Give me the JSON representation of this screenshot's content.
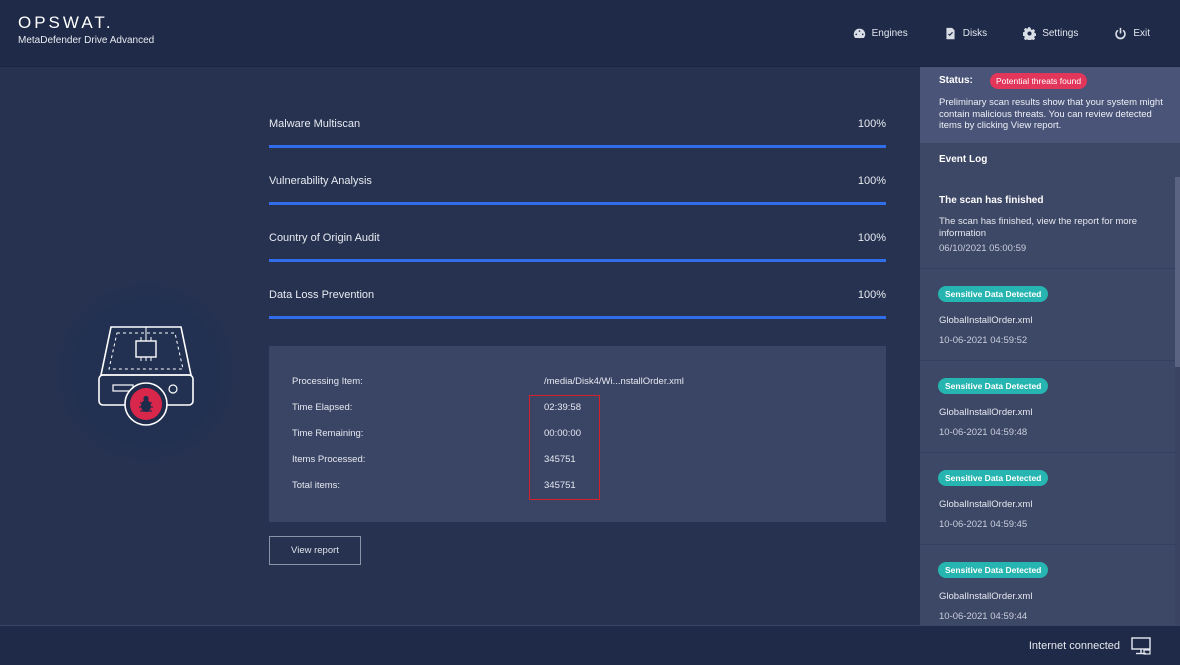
{
  "header": {
    "logo": "OPSWAT.",
    "product": "MetaDefender Drive Advanced",
    "nav": [
      {
        "label": "Engines",
        "icon": "gauge-icon"
      },
      {
        "label": "Disks",
        "icon": "disk-icon"
      },
      {
        "label": "Settings",
        "icon": "gear-icon"
      },
      {
        "label": "Exit",
        "icon": "power-icon"
      }
    ]
  },
  "progress": [
    {
      "label": "Malware Multiscan",
      "percent_text": "100%",
      "percent": 100
    },
    {
      "label": "Vulnerability Analysis",
      "percent_text": "100%",
      "percent": 100
    },
    {
      "label": "Country of Origin Audit",
      "percent_text": "100%",
      "percent": 100
    },
    {
      "label": "Data Loss Prevention",
      "percent_text": "100%",
      "percent": 100
    }
  ],
  "info": {
    "processing_item_label": "Processing Item:",
    "processing_item_value": "/media/Disk4/Wi...nstallOrder.xml",
    "time_elapsed_label": "Time Elapsed:",
    "time_elapsed_value": "02:39:58",
    "time_remaining_label": "Time Remaining:",
    "time_remaining_value": "00:00:00",
    "items_processed_label": "Items Processed:",
    "items_processed_value": "345751",
    "total_items_label": "Total items:",
    "total_items_value": "345751"
  },
  "view_report_label": "View report",
  "sidebar": {
    "status_label": "Status:",
    "status_badge": "Potential threats found",
    "status_text": "Preliminary scan results show that your system might contain malicious threats. You can review detected items by clicking View report.",
    "event_log_title": "Event Log",
    "first_event": {
      "title": "The scan has finished",
      "desc": "The scan has finished, view the report for more information",
      "time": "06/10/2021 05:00:59"
    },
    "events": [
      {
        "badge": "Sensitive Data Detected",
        "file": "GlobalInstallOrder.xml",
        "time": "10-06-2021 04:59:52"
      },
      {
        "badge": "Sensitive Data Detected",
        "file": "GlobalInstallOrder.xml",
        "time": "10-06-2021 04:59:48"
      },
      {
        "badge": "Sensitive Data Detected",
        "file": "GlobalInstallOrder.xml",
        "time": "10-06-2021 04:59:45"
      },
      {
        "badge": "Sensitive Data Detected",
        "file": "GlobalInstallOrder.xml",
        "time": "10-06-2021 04:59:44"
      }
    ]
  },
  "footer": {
    "status": "Internet connected",
    "icon": "monitor-icon"
  },
  "colors": {
    "progress_fill": "#2f6dea",
    "threat_badge": "#e2365a",
    "sensitive_badge": "#26b5b0",
    "highlight_border": "#d4222d"
  }
}
